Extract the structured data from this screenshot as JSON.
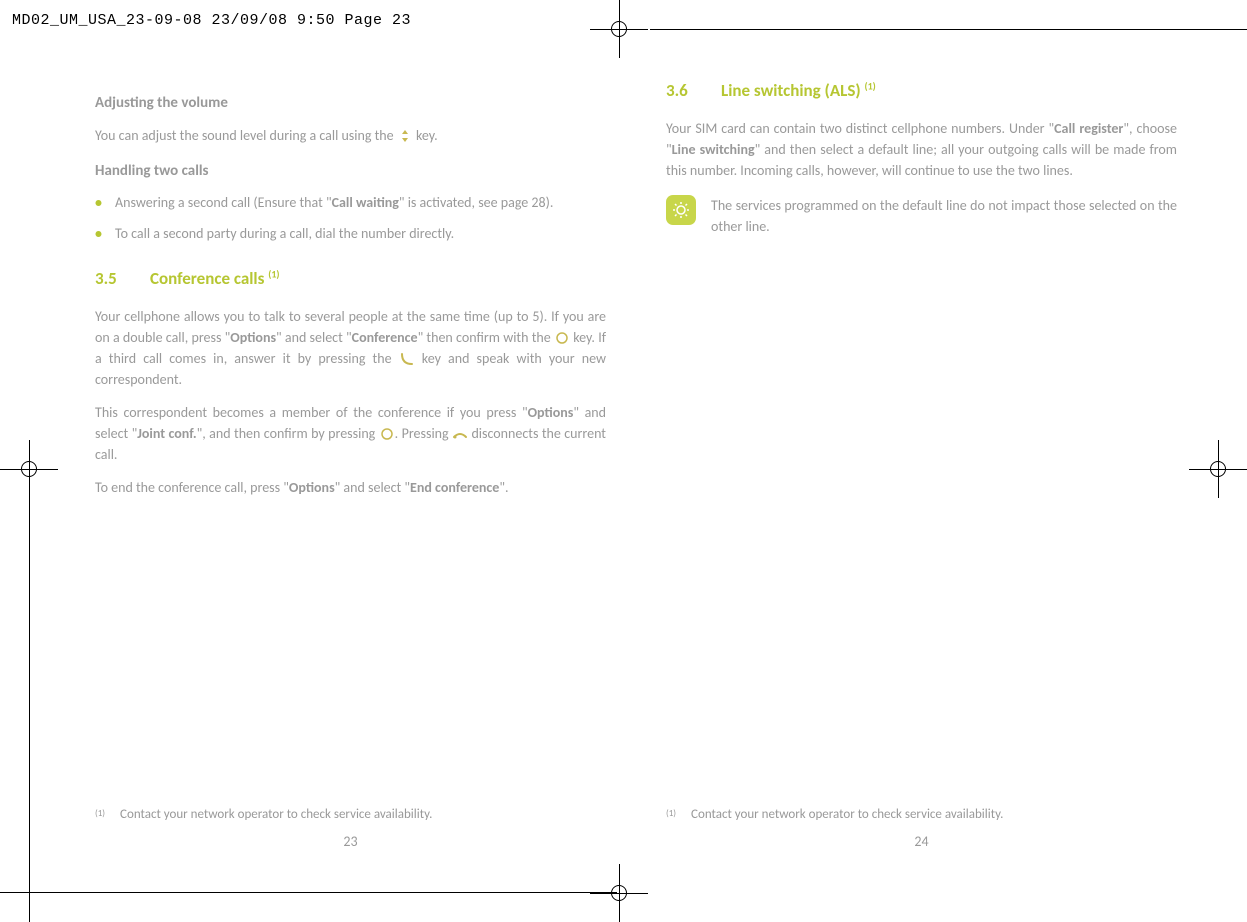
{
  "print_header": "MD02_UM_USA_23-09-08  23/09/08  9:50  Page 23",
  "left": {
    "heading1": "Adjusting the volume",
    "para1_pre": "You can adjust the sound level during a call using the ",
    "para1_post": " key.",
    "heading2": "Handling two calls",
    "bullet1_pre": "Answering a second call (Ensure that \"",
    "bullet1_bold": "Call waiting",
    "bullet1_post": "\" is activated, see page 28).",
    "bullet2": "To call a second party during a call, dial the number directly.",
    "section_num": "3.5",
    "section_title": "Conference calls ",
    "section_sup": "(1)",
    "para3_a": "Your cellphone allows you to talk to several people at the same time (up to 5). If you are on a double call, press \"",
    "para3_b": "Options",
    "para3_c": "\" and select \"",
    "para3_d": "Conference",
    "para3_e": "\" then confirm with the ",
    "para3_f": " key. If a third call comes in, answer it by pressing the ",
    "para3_g": " key and speak with your new correspondent.",
    "para4_a": "This correspondent becomes a member of the conference if you press \"",
    "para4_b": "Options",
    "para4_c": "\" and select \"",
    "para4_d": "Joint conf.",
    "para4_e": "\", and then confirm by pressing ",
    "para4_f": ". Pressing ",
    "para4_g": " disconnects the current call.",
    "para5_a": "To end the conference call, press \"",
    "para5_b": "Options",
    "para5_c": "\" and select \"",
    "para5_d": "End conference",
    "para5_e": "\".",
    "footnote_sup": "(1)",
    "footnote": "Contact your network operator to check service availability.",
    "page_num": "23"
  },
  "right": {
    "section_num": "3.6",
    "section_title": "Line switching (ALS) ",
    "section_sup": "(1)",
    "para1_a": "Your SIM card can contain two distinct cellphone numbers. Under \"",
    "para1_b": "Call register",
    "para1_c": "\", choose \"",
    "para1_d": "Line switching",
    "para1_e": "\" and then select a default line; all your outgoing calls will be made from this number. Incoming calls, however, will continue to use the two lines.",
    "tip": "The services programmed on the default line do not impact those selected on the other line.",
    "footnote_sup": "(1)",
    "footnote": "Contact your network operator to check service availability.",
    "page_num": "24"
  }
}
